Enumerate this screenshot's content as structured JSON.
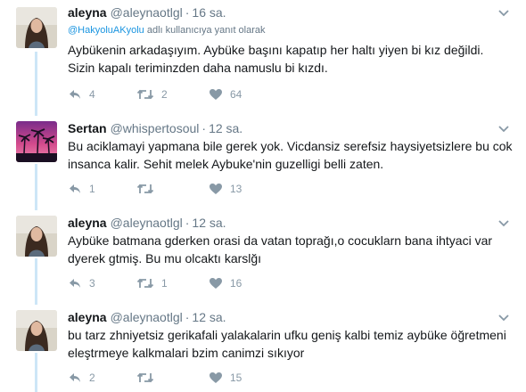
{
  "tweets": [
    {
      "name": "aleyna",
      "handle": "@aleynaotlgl",
      "time": "16 sa.",
      "reply_to": {
        "handle": "@HakyoluAKyolu",
        "suffix": "adlı kullanıcıya yanıt olarak"
      },
      "lines": [
        "Aybükenin arkadaşıyım. Aybüke başını kapatıp her haltı yiyen bi kız değildi.",
        "Sizin kapalı teriminzden daha namuslu bi kızdı."
      ],
      "replies": "4",
      "retweets": "2",
      "likes": "64"
    },
    {
      "name": "Sertan",
      "handle": "@whispertosoul",
      "time": "12 sa.",
      "lines": [
        "Bu aciklamayi yapmana bile gerek yok. Vicdansiz serefsiz haysiyetsizlere bu cok",
        "insanca kalir. Sehit melek Aybuke'nin guzelligi belli zaten."
      ],
      "replies": "1",
      "retweets": "",
      "likes": "13"
    },
    {
      "name": "aleyna",
      "handle": "@aleynaotlgl",
      "time": "12 sa.",
      "lines": [
        "Aybüke batmana gderken orasi da vatan toprağı,o cocuklarn bana ihtyaci var",
        "dyerek gtmiş. Bu mu olcaktı karslğı"
      ],
      "replies": "3",
      "retweets": "1",
      "likes": "16"
    },
    {
      "name": "aleyna",
      "handle": "@aleynaotlgl",
      "time": "12 sa.",
      "lines": [
        "bu tarz zhniyetsiz gerikafali yalakalarin ufku geniş kalbi temiz aybüke öğretmeni",
        "eleştrmeye kalkmalari bzim canimzi sıkıyor"
      ],
      "replies": "2",
      "retweets": "",
      "likes": "15"
    }
  ],
  "icons": {
    "reply": "reply-icon",
    "retweet": "retweet-icon",
    "like": "heart-icon",
    "menu": "chevron-down-icon"
  },
  "colors": {
    "thread": "#cde6f7",
    "link": "#1b95e0",
    "muted": "#657786",
    "action": "#8899a6"
  }
}
